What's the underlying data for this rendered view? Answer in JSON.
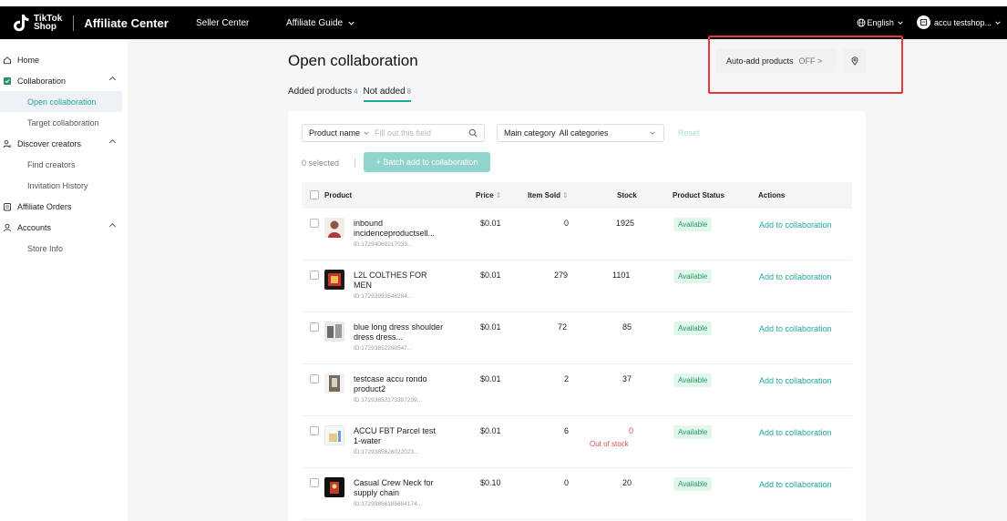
{
  "topbar": {
    "logo_line1": "TikTok",
    "logo_line2": "Shop",
    "app_title": "Affiliate Center",
    "seller_center": "Seller Center",
    "affiliate_guide": "Affiliate Guide",
    "language": "English",
    "store_name": "accu testshop..."
  },
  "sidebar": {
    "home": "Home",
    "collaboration": "Collaboration",
    "open_collaboration": "Open collaboration",
    "target_collaboration": "Target collaboration",
    "discover_creators": "Discover creators",
    "find_creators": "Find creators",
    "invitation_history": "Invitation History",
    "affiliate_orders": "Affiliate Orders",
    "accounts": "Accounts",
    "store_info": "Store Info"
  },
  "page": {
    "title": "Open collaboration",
    "tabs": [
      {
        "label": "Added products",
        "count": "4"
      },
      {
        "label": "Not added",
        "count": "8"
      }
    ],
    "auto_add_label": "Auto-add products",
    "auto_add_state": "OFF >"
  },
  "filters": {
    "product_name_label": "Product name",
    "product_name_placeholder": "Fill out this field",
    "main_category_label": "Main category",
    "main_category_value": "All categories",
    "reset": "Reset",
    "selected": "0 selected",
    "batch_add": "+ Batch add to collaboration"
  },
  "table": {
    "headers": {
      "product": "Product",
      "price": "Price",
      "item_sold": "Item Sold",
      "stock": "Stock",
      "status": "Product Status",
      "actions": "Actions"
    },
    "rows": [
      {
        "name": "inbound incidenceproductsell...",
        "id": "ID:17294060217033...",
        "price": "$0.01",
        "sold": "0",
        "stock": "1925",
        "status": "Available",
        "action": "Add to collaboration",
        "stock_note": ""
      },
      {
        "name": "L2L COLTHES FOR MEN",
        "id": "ID:17293993546284...",
        "price": "$0.01",
        "sold": "279",
        "stock": "1101",
        "status": "Available",
        "action": "Add to collaboration",
        "stock_note": ""
      },
      {
        "name": "blue long dress shoulder dress dress...",
        "id": "ID:17293852260547...",
        "price": "$0.01",
        "sold": "72",
        "stock": "85",
        "status": "Available",
        "action": "Add to collaboration",
        "stock_note": ""
      },
      {
        "name": "testcase accu rondo product2",
        "id": "ID:17293852173397239...",
        "price": "$0.01",
        "sold": "2",
        "stock": "37",
        "status": "Available",
        "action": "Add to collaboration",
        "stock_note": ""
      },
      {
        "name": "ACCU FBT Parcel test 1-water",
        "id": "ID:1729385626022023...",
        "price": "$0.01",
        "sold": "6",
        "stock": "0",
        "status": "Available",
        "action": "Add to collaboration",
        "stock_note": "Out of stock"
      },
      {
        "name": "Casual Crew Neck for supply chain",
        "id": "ID:17293856185684174...",
        "price": "$0.10",
        "sold": "0",
        "stock": "20",
        "status": "Available",
        "action": "Add to collaboration",
        "stock_note": ""
      }
    ]
  },
  "colors": {
    "accent": "#1ea89b",
    "highlight_box": "#e03a3a",
    "out_of_stock": "#e5484d"
  }
}
